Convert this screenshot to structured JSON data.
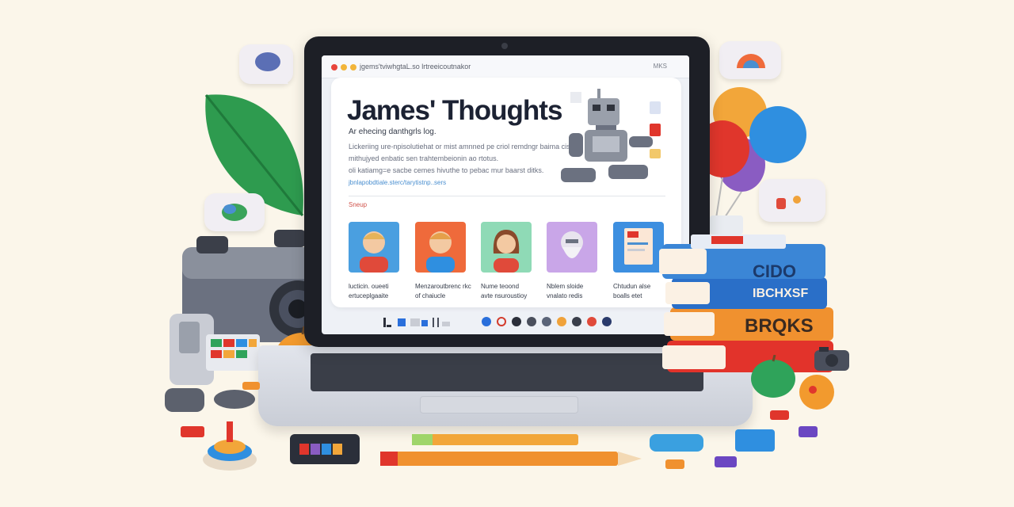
{
  "window": {
    "url": "jgems'tviwhgtaL.so lrtreeicoutnakor",
    "right_label": "MKS"
  },
  "blog": {
    "title": "James' Thoughts",
    "subtitle": "Ar ehecing danthgrls log.",
    "paragraphs": [
      "Lickeriing ure-npisolutiehat or mist amnned pe criol remdngr baima cistle",
      "mithujyed enbatic sen trahtembeionin ao rtotus.",
      "oli katiamg=e sacbe cemes hivuthe to pebac mur baarst ditks."
    ],
    "link": "jbnlapobdtiale.sterc/tarytistnp..sers",
    "section_label": "Sneup",
    "posts": [
      {
        "line1": "lucticin. oueeti",
        "line2": "ertuceplgaaite",
        "bg": "#4a9fe0",
        "icon": "boy-avatar-icon"
      },
      {
        "line1": "Menzaroutbrenc rkc",
        "line2": "of chaiucle",
        "bg": "#ef6a3b",
        "icon": "boy-avatar-icon"
      },
      {
        "line1": "Nume teoond",
        "line2": "avte nsuroustioy",
        "bg": "#8fdab6",
        "icon": "girl-avatar-icon"
      },
      {
        "line1": "Nblem sloide",
        "line2": "vnalato redis",
        "bg": "#c9a6e8",
        "icon": "old-man-avatar-icon"
      },
      {
        "line1": "Chtudun alse",
        "line2": "boalls etet",
        "bg": "#3d8fe0",
        "icon": "book-icon"
      }
    ]
  },
  "taskbar": {
    "colors": [
      "#2a6fdb",
      "#d33b2c",
      "#2b2f3a",
      "#4a4f5c",
      "#5b6478",
      "#f0a23a",
      "#3a3f4b",
      "#e04a3a",
      "#2a3a6b"
    ]
  },
  "books": {
    "spine1": "CIDO",
    "spine2": "IBCHXSF",
    "spine3": "BRQKS"
  },
  "colors": {
    "background": "#fbf6ea",
    "accent": "#d0534b",
    "title": "#1c2233"
  }
}
